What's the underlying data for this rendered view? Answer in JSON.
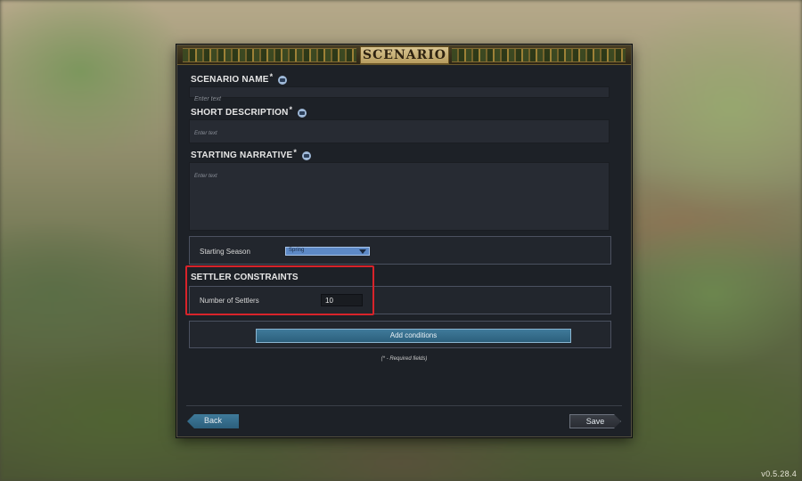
{
  "title": "SCENARIO",
  "fields": {
    "scenario_name": {
      "label": "SCENARIO NAME",
      "required_mark": "*",
      "placeholder": "Enter text"
    },
    "short_description": {
      "label": "SHORT DESCRIPTION",
      "required_mark": "*",
      "placeholder": "Enter text"
    },
    "starting_narrative": {
      "label": "STARTING NARRATIVE",
      "required_mark": "*",
      "placeholder": "Enter text"
    }
  },
  "season": {
    "label": "Starting Season",
    "value": "Spring"
  },
  "settler_constraints": {
    "title": "SETTLER CONSTRAINTS",
    "number_label": "Number of Settlers",
    "number_value": "10"
  },
  "add_conditions_label": "Add conditions",
  "required_note": "(* - Required fields)",
  "buttons": {
    "back": "Back",
    "save": "Save"
  },
  "version": "v0.5.28.4",
  "colors": {
    "accent": "#3f7a9a",
    "highlight": "#d8232a",
    "panel": "#1d2127"
  },
  "icons": {
    "info": "info-icon",
    "dropdown": "chevron-down-icon"
  }
}
